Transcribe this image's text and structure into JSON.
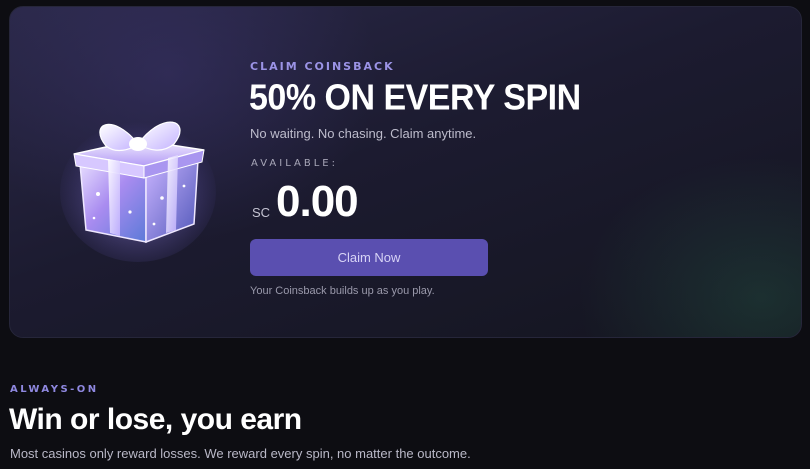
{
  "promo_card": {
    "eyebrow": "CLAIM COINSBACK",
    "headline": "50% ON EVERY SPIN",
    "subtext": "No waiting. No chasing. Claim anytime.",
    "available_label": "AVAILABLE:",
    "currency": "SC",
    "amount": "0.00",
    "claim_button_label": "Claim Now",
    "note": "Your Coinsback builds up as you play.",
    "icon": "gift-box-icon"
  },
  "section": {
    "eyebrow": "ALWAYS-ON",
    "title": "Win or lose, you earn",
    "description": "Most casinos only reward losses. We reward every spin, no matter the outcome."
  },
  "colors": {
    "background": "#0d0d12",
    "accent": "#9b93e6",
    "button": "#5a4fb0"
  }
}
